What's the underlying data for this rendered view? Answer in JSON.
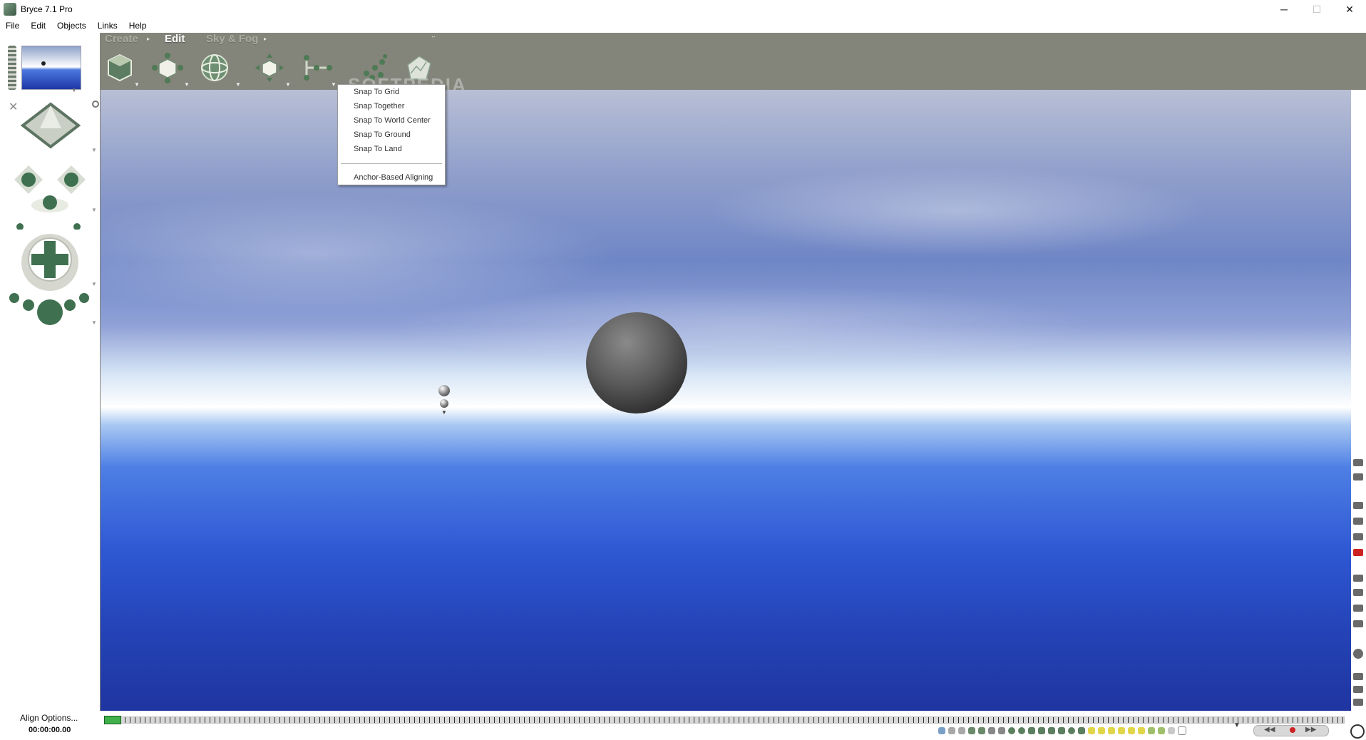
{
  "window": {
    "title": "Bryce 7.1  Pro",
    "controls": {
      "minimize": "─",
      "maximize": "☐",
      "close": "✕"
    }
  },
  "menu": [
    "File",
    "Edit",
    "Objects",
    "Links",
    "Help"
  ],
  "palette_tabs": [
    {
      "label": "Create",
      "active": false
    },
    {
      "label": "Edit",
      "active": true
    },
    {
      "label": "Sky & Fog",
      "active": false
    }
  ],
  "watermark": "SOFTPEDIA",
  "toolbar_icons": [
    "material-lab-icon",
    "resize-icon",
    "rotate-icon",
    "reposition-icon",
    "align-icon",
    "randomize-icon",
    "terrain-editor-icon"
  ],
  "context_menu": {
    "items": [
      "Snap To Grid",
      "Snap Together",
      "Snap To World Center",
      "Snap To Ground",
      "Snap To Land"
    ],
    "extra_item": "Anchor-Based Aligning"
  },
  "left_panel": {
    "status_label": "Align Options...",
    "time": "00:00:00.00"
  },
  "colors": {
    "workspace": "#83847a",
    "accent_green": "#3fb04a",
    "sky_blue": "#2e57d3"
  }
}
